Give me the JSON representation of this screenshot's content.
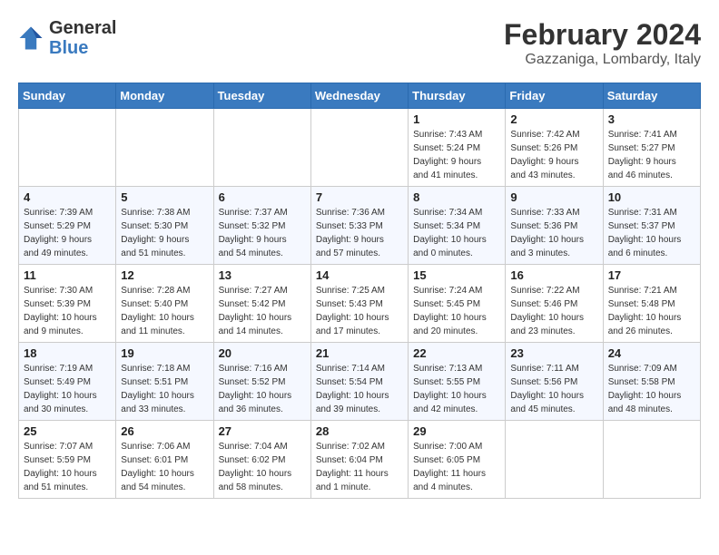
{
  "logo": {
    "text_general": "General",
    "text_blue": "Blue"
  },
  "header": {
    "month_year": "February 2024",
    "location": "Gazzaniga, Lombardy, Italy"
  },
  "days_of_week": [
    "Sunday",
    "Monday",
    "Tuesday",
    "Wednesday",
    "Thursday",
    "Friday",
    "Saturday"
  ],
  "weeks": [
    [
      {
        "day": "",
        "info": ""
      },
      {
        "day": "",
        "info": ""
      },
      {
        "day": "",
        "info": ""
      },
      {
        "day": "",
        "info": ""
      },
      {
        "day": "1",
        "info": "Sunrise: 7:43 AM\nSunset: 5:24 PM\nDaylight: 9 hours\nand 41 minutes."
      },
      {
        "day": "2",
        "info": "Sunrise: 7:42 AM\nSunset: 5:26 PM\nDaylight: 9 hours\nand 43 minutes."
      },
      {
        "day": "3",
        "info": "Sunrise: 7:41 AM\nSunset: 5:27 PM\nDaylight: 9 hours\nand 46 minutes."
      }
    ],
    [
      {
        "day": "4",
        "info": "Sunrise: 7:39 AM\nSunset: 5:29 PM\nDaylight: 9 hours\nand 49 minutes."
      },
      {
        "day": "5",
        "info": "Sunrise: 7:38 AM\nSunset: 5:30 PM\nDaylight: 9 hours\nand 51 minutes."
      },
      {
        "day": "6",
        "info": "Sunrise: 7:37 AM\nSunset: 5:32 PM\nDaylight: 9 hours\nand 54 minutes."
      },
      {
        "day": "7",
        "info": "Sunrise: 7:36 AM\nSunset: 5:33 PM\nDaylight: 9 hours\nand 57 minutes."
      },
      {
        "day": "8",
        "info": "Sunrise: 7:34 AM\nSunset: 5:34 PM\nDaylight: 10 hours\nand 0 minutes."
      },
      {
        "day": "9",
        "info": "Sunrise: 7:33 AM\nSunset: 5:36 PM\nDaylight: 10 hours\nand 3 minutes."
      },
      {
        "day": "10",
        "info": "Sunrise: 7:31 AM\nSunset: 5:37 PM\nDaylight: 10 hours\nand 6 minutes."
      }
    ],
    [
      {
        "day": "11",
        "info": "Sunrise: 7:30 AM\nSunset: 5:39 PM\nDaylight: 10 hours\nand 9 minutes."
      },
      {
        "day": "12",
        "info": "Sunrise: 7:28 AM\nSunset: 5:40 PM\nDaylight: 10 hours\nand 11 minutes."
      },
      {
        "day": "13",
        "info": "Sunrise: 7:27 AM\nSunset: 5:42 PM\nDaylight: 10 hours\nand 14 minutes."
      },
      {
        "day": "14",
        "info": "Sunrise: 7:25 AM\nSunset: 5:43 PM\nDaylight: 10 hours\nand 17 minutes."
      },
      {
        "day": "15",
        "info": "Sunrise: 7:24 AM\nSunset: 5:45 PM\nDaylight: 10 hours\nand 20 minutes."
      },
      {
        "day": "16",
        "info": "Sunrise: 7:22 AM\nSunset: 5:46 PM\nDaylight: 10 hours\nand 23 minutes."
      },
      {
        "day": "17",
        "info": "Sunrise: 7:21 AM\nSunset: 5:48 PM\nDaylight: 10 hours\nand 26 minutes."
      }
    ],
    [
      {
        "day": "18",
        "info": "Sunrise: 7:19 AM\nSunset: 5:49 PM\nDaylight: 10 hours\nand 30 minutes."
      },
      {
        "day": "19",
        "info": "Sunrise: 7:18 AM\nSunset: 5:51 PM\nDaylight: 10 hours\nand 33 minutes."
      },
      {
        "day": "20",
        "info": "Sunrise: 7:16 AM\nSunset: 5:52 PM\nDaylight: 10 hours\nand 36 minutes."
      },
      {
        "day": "21",
        "info": "Sunrise: 7:14 AM\nSunset: 5:54 PM\nDaylight: 10 hours\nand 39 minutes."
      },
      {
        "day": "22",
        "info": "Sunrise: 7:13 AM\nSunset: 5:55 PM\nDaylight: 10 hours\nand 42 minutes."
      },
      {
        "day": "23",
        "info": "Sunrise: 7:11 AM\nSunset: 5:56 PM\nDaylight: 10 hours\nand 45 minutes."
      },
      {
        "day": "24",
        "info": "Sunrise: 7:09 AM\nSunset: 5:58 PM\nDaylight: 10 hours\nand 48 minutes."
      }
    ],
    [
      {
        "day": "25",
        "info": "Sunrise: 7:07 AM\nSunset: 5:59 PM\nDaylight: 10 hours\nand 51 minutes."
      },
      {
        "day": "26",
        "info": "Sunrise: 7:06 AM\nSunset: 6:01 PM\nDaylight: 10 hours\nand 54 minutes."
      },
      {
        "day": "27",
        "info": "Sunrise: 7:04 AM\nSunset: 6:02 PM\nDaylight: 10 hours\nand 58 minutes."
      },
      {
        "day": "28",
        "info": "Sunrise: 7:02 AM\nSunset: 6:04 PM\nDaylight: 11 hours\nand 1 minute."
      },
      {
        "day": "29",
        "info": "Sunrise: 7:00 AM\nSunset: 6:05 PM\nDaylight: 11 hours\nand 4 minutes."
      },
      {
        "day": "",
        "info": ""
      },
      {
        "day": "",
        "info": ""
      }
    ]
  ]
}
